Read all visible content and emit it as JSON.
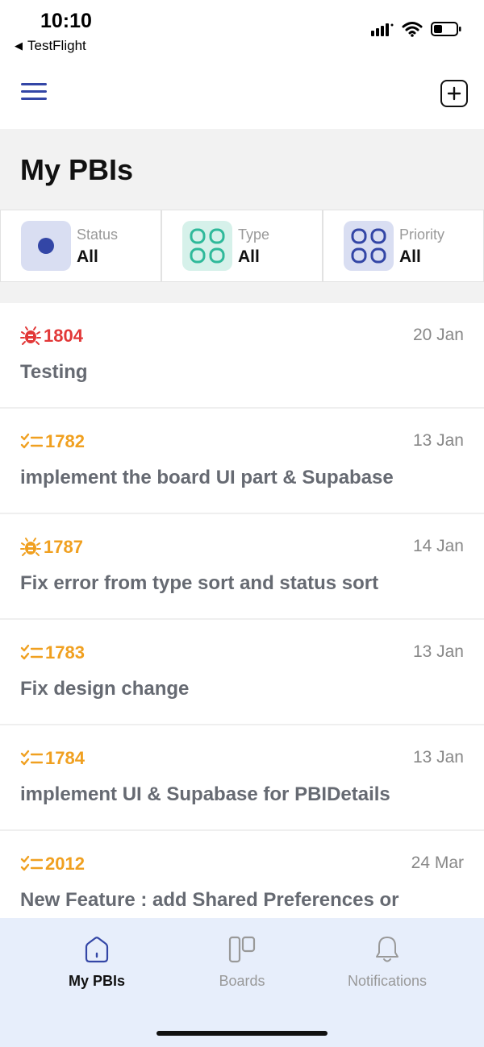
{
  "status_bar": {
    "time": "10:10",
    "back_app": "TestFlight",
    "icons": [
      "signal-icon",
      "wifi-icon",
      "battery-icon"
    ]
  },
  "header": {
    "menu_icon": "hamburger-menu-icon",
    "add_icon": "add-square-icon"
  },
  "page": {
    "title": "My PBIs"
  },
  "filters": [
    {
      "label": "Status",
      "value": "All",
      "icon": "dot-icon",
      "bg": "#d9def2"
    },
    {
      "label": "Type",
      "value": "All",
      "icon": "grid-icon",
      "bg": "#d6f1ea"
    },
    {
      "label": "Priority",
      "value": "All",
      "icon": "grid-icon",
      "bg": "#d9def2"
    }
  ],
  "items": [
    {
      "id": "1804",
      "type": "bug",
      "color": "#e23838",
      "date": "20 Jan",
      "title": "Testing"
    },
    {
      "id": "1782",
      "type": "task",
      "color": "#f0a020",
      "date": "13 Jan",
      "title": "implement the board UI part & Supabase"
    },
    {
      "id": "1787",
      "type": "bug",
      "color": "#f0a020",
      "date": "14 Jan",
      "title": "Fix error from type sort and status sort"
    },
    {
      "id": "1783",
      "type": "task",
      "color": "#f0a020",
      "date": "13 Jan",
      "title": "Fix design change"
    },
    {
      "id": "1784",
      "type": "task",
      "color": "#f0a020",
      "date": "13 Jan",
      "title": "implement UI & Supabase for PBIDetails"
    },
    {
      "id": "2012",
      "type": "task",
      "color": "#f0a020",
      "date": "24 Mar",
      "title": "New Feature : add  Shared Preferences or"
    }
  ],
  "tabs": [
    {
      "label": "My PBIs",
      "icon": "home-icon",
      "active": true
    },
    {
      "label": "Boards",
      "icon": "boards-icon",
      "active": false
    },
    {
      "label": "Notifications",
      "icon": "bell-icon",
      "active": false
    }
  ],
  "colors": {
    "accent": "#3346a6",
    "bug_red": "#e23838",
    "task_orange": "#f0a020",
    "tab_bar_bg": "#e7eefb"
  }
}
